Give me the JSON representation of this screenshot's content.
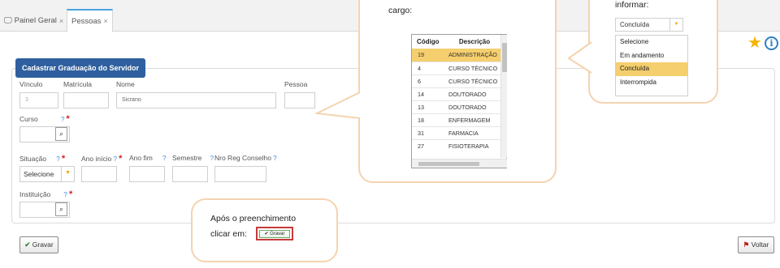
{
  "tabs": [
    {
      "label": "Painel Geral",
      "close": "×"
    },
    {
      "label": "Pessoas",
      "close": "×"
    }
  ],
  "panel": {
    "legend": "Cadastrar Graduação do Servidor"
  },
  "form": {
    "vinculo": {
      "label": "Vínculo",
      "value": "3"
    },
    "matricula": {
      "label": "Matrícula",
      "value": ""
    },
    "nome": {
      "label": "Nome",
      "value": "Sicrano"
    },
    "pessoa": {
      "label": "Pessoa",
      "value": ""
    },
    "curso": {
      "label": "Curso",
      "help": "?",
      "required": "*"
    },
    "situacao": {
      "label": "Situação",
      "help": "?",
      "required": "*",
      "value": "Selecione",
      "arrow": "▼"
    },
    "ano_inicio": {
      "label": "Ano início",
      "help": "?",
      "required": "*"
    },
    "ano_fim": {
      "label": "Ano fim",
      "help": "?"
    },
    "semestre": {
      "label": "Semestre",
      "help": "?"
    },
    "nro_reg_conselho": {
      "label": "Nro Reg Conselho",
      "help": "?"
    },
    "instituicao": {
      "label": "Instituição",
      "help": "?",
      "required": "*"
    },
    "search_glyph": "⌕"
  },
  "buttons": {
    "gravar": {
      "icon": "✔",
      "label": "Gravar"
    },
    "voltar": {
      "icon": "⚑",
      "label": "Voltar"
    }
  },
  "callout_cargo": {
    "text": "cargo:",
    "columns": {
      "codigo": "Código",
      "descricao": "Descrição"
    },
    "rows": [
      {
        "codigo": "19",
        "descricao": "ADMINISTRAÇÃO",
        "selected": true
      },
      {
        "codigo": "4",
        "descricao": "CURSO TÉCNICO"
      },
      {
        "codigo": "6",
        "descricao": "CURSO TÉCNICO"
      },
      {
        "codigo": "14",
        "descricao": "DOUTORADO"
      },
      {
        "codigo": "13",
        "descricao": "DOUTORADO"
      },
      {
        "codigo": "18",
        "descricao": "ENFERMAGEM"
      },
      {
        "codigo": "31",
        "descricao": "FARMACIA"
      },
      {
        "codigo": "27",
        "descricao": "FISIOTERAPIA"
      }
    ]
  },
  "callout_situacao": {
    "text": "informar:",
    "selected": "Concluída",
    "arrow": "▼",
    "options": [
      "Selecione",
      "Em andamento",
      "Concluída",
      "Interrompida"
    ]
  },
  "callout_gravar": {
    "line1": "Após o preenchimento",
    "line2": "clicar em:",
    "button_label": "✔ Gravar"
  },
  "icons": {
    "favorite": "★",
    "info": "i"
  },
  "colors": {
    "accent": "#2f5f9e",
    "selected_row": "#f5cf6e",
    "callout_border": "#f4d3b0",
    "star": "#f5b400"
  }
}
